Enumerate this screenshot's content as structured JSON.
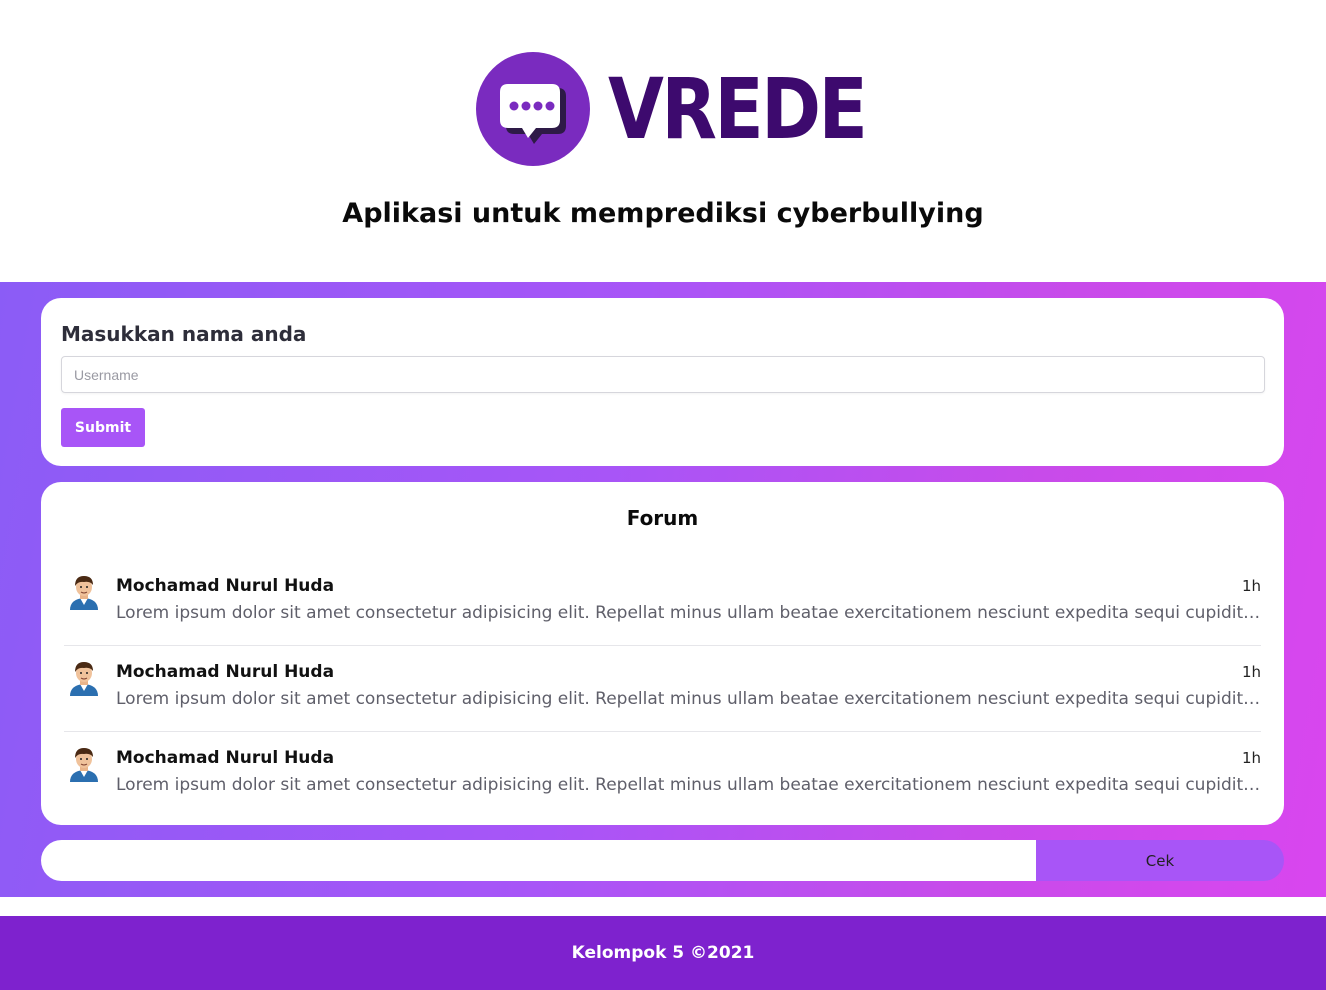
{
  "brand": {
    "name": "VREDE",
    "tagline": "Aplikasi untuk memprediksi cyberbullying",
    "logo_icon": "chat-bubble-icon"
  },
  "name_form": {
    "title": "Masukkan nama anda",
    "username_placeholder": "Username",
    "username_value": "",
    "submit_label": "Submit"
  },
  "forum": {
    "title": "Forum",
    "posts": [
      {
        "author": "Mochamad Nurul Huda",
        "time": "1h",
        "body": "Lorem ipsum dolor sit amet consectetur adipisicing elit. Repellat minus ullam beatae exercitationem nesciunt expedita sequi cupiditate",
        "avatar_icon": "user-avatar-icon"
      },
      {
        "author": "Mochamad Nurul Huda",
        "time": "1h",
        "body": "Lorem ipsum dolor sit amet consectetur adipisicing elit. Repellat minus ullam beatae exercitationem nesciunt expedita sequi cupiditate",
        "avatar_icon": "user-avatar-icon"
      },
      {
        "author": "Mochamad Nurul Huda",
        "time": "1h",
        "body": "Lorem ipsum dolor sit amet consectetur adipisicing elit. Repellat minus ullam beatae exercitationem nesciunt expedita sequi cupiditate",
        "avatar_icon": "user-avatar-icon"
      }
    ]
  },
  "check": {
    "input_value": "",
    "button_label": "Cek"
  },
  "footer": {
    "text": "Kelompok 5 ©2021"
  },
  "colors": {
    "primary": "#a855f7",
    "footer": "#7e22ce",
    "logo_text": "#3d0a6e",
    "logo_circle": "#7a2bbf"
  }
}
